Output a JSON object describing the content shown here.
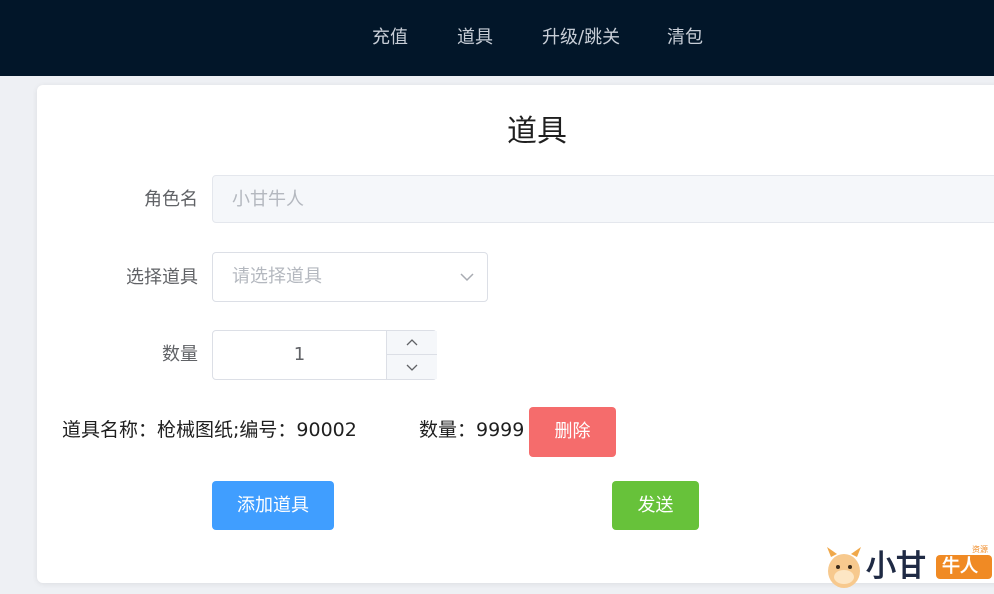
{
  "nav": {
    "items": [
      {
        "label": "充值"
      },
      {
        "label": "道具"
      },
      {
        "label": "升级/跳关"
      },
      {
        "label": "清包"
      }
    ]
  },
  "page": {
    "title": "道具"
  },
  "form": {
    "role_label": "角色名",
    "role_value": "小甘牛人",
    "select_label": "选择道具",
    "select_placeholder": "请选择道具",
    "quantity_label": "数量",
    "quantity_value": "1"
  },
  "item_row": {
    "name_text": "道具名称：枪械图纸;编号：90002",
    "count_text": "数量：9999",
    "delete_label": "删除"
  },
  "actions": {
    "add_label": "添加道具",
    "send_label": "发送"
  },
  "watermark": {
    "text": "小甘",
    "tag": "牛人",
    "small": "资源网"
  },
  "colors": {
    "navbar": "#021629",
    "primary": "#409eff",
    "danger": "#f56c6c",
    "success": "#67c23a"
  },
  "icons": [
    "chevron-down-icon",
    "chevron-up-icon",
    "cow-logo-icon"
  ]
}
